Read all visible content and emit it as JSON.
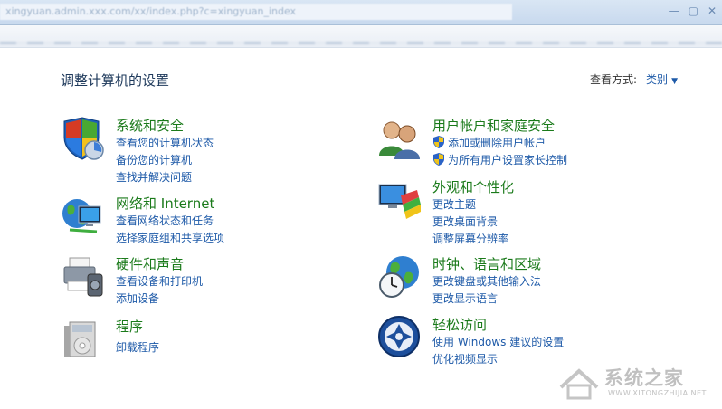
{
  "window": {
    "address_blurred": "xingyuan.admin.xxx.com/xx/index.php?c=xingyuan_index",
    "controls": [
      "—",
      "▢",
      "✕"
    ]
  },
  "header": {
    "title": "调整计算机的设置",
    "view_by_label": "查看方式:",
    "view_by_value": "类别",
    "view_by_caret": "▼"
  },
  "categories": {
    "system_security": {
      "title": "系统和安全",
      "links": [
        "查看您的计算机状态",
        "备份您的计算机",
        "查找并解决问题"
      ]
    },
    "network": {
      "title": "网络和 Internet",
      "links": [
        "查看网络状态和任务",
        "选择家庭组和共享选项"
      ]
    },
    "hardware": {
      "title": "硬件和声音",
      "links": [
        "查看设备和打印机",
        "添加设备"
      ]
    },
    "programs": {
      "title": "程序",
      "links": [
        "卸载程序"
      ]
    },
    "user_accounts": {
      "title": "用户帐户和家庭安全",
      "links": [
        "添加或删除用户帐户",
        "为所有用户设置家长控制"
      ]
    },
    "appearance": {
      "title": "外观和个性化",
      "links": [
        "更改主题",
        "更改桌面背景",
        "调整屏幕分辨率"
      ]
    },
    "clock_region": {
      "title": "时钟、语言和区域",
      "links": [
        "更改键盘或其他输入法",
        "更改显示语言"
      ]
    },
    "ease_access": {
      "title": "轻松访问",
      "links": [
        "使用 Windows 建议的设置",
        "优化视频显示"
      ]
    }
  },
  "watermark": {
    "text": "系统之家",
    "url": "WWW.XITONGZHIJIA.NET"
  },
  "colors": {
    "title_green": "#1a7a1a",
    "link_blue": "#1e5aa8",
    "header_text": "#1e395b"
  }
}
